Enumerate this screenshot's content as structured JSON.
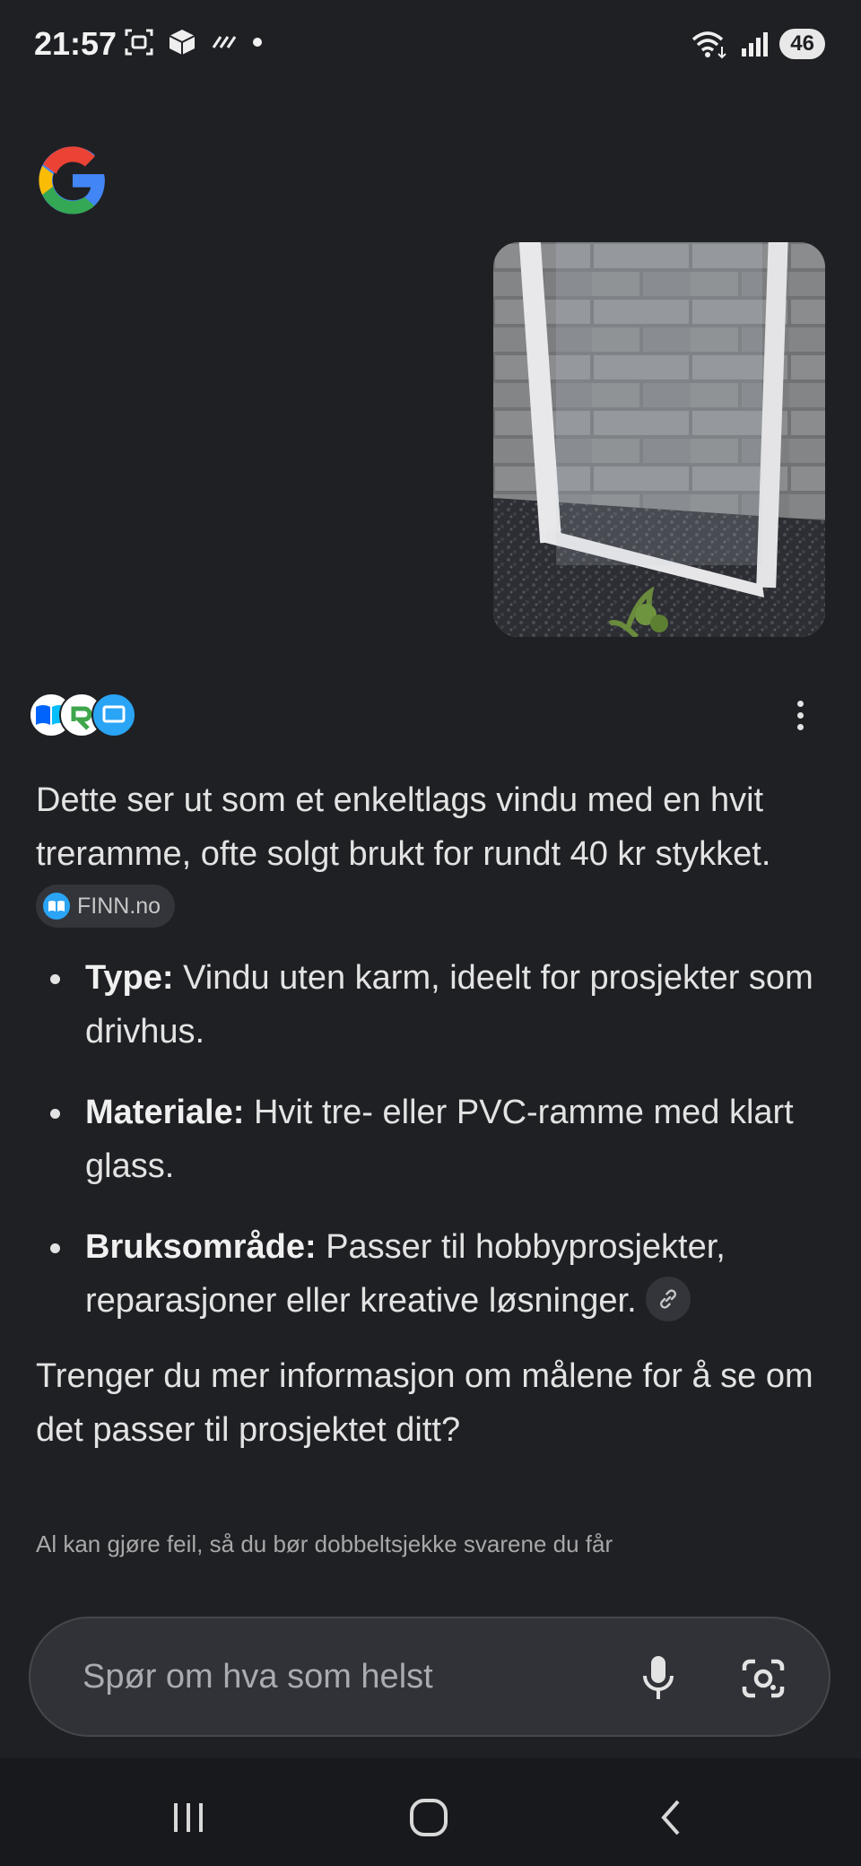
{
  "status_bar": {
    "time": "21:57",
    "icons_left": [
      "screenshot-icon",
      "cube-icon",
      "signal-stripes-icon",
      "notification-dot-icon"
    ],
    "icons_right": [
      "wifi-icon",
      "cell-signal-icon",
      "battery-icon"
    ],
    "battery": "46"
  },
  "header": {
    "logo": "google-g-logo"
  },
  "user_message": {
    "image": "photo-of-white-window-frame-against-brick-wall"
  },
  "response": {
    "sources": [
      "source-favicon-finn",
      "source-favicon-recycle",
      "source-favicon-blue"
    ],
    "intro": "Dette ser ut som et enkeltlags vindu med en hvit treramme, ofte solgt brukt for rundt 40 kr stykket.",
    "intro_chip": "FINN.no",
    "bullets": [
      {
        "term": "Type:",
        "text": " Vindu uten karm, ideelt for prosjekter som drivhus."
      },
      {
        "term": "Materiale:",
        "text": " Hvit tre- eller PVC-ramme med klart glass."
      },
      {
        "term": "Bruksområde:",
        "text": " Passer til hobbyprosjekter, reparasjoner eller kreative løsninger."
      }
    ],
    "followup": "Trenger du mer informasjon om målene for å se om det passer til prosjektet ditt?",
    "disclaimer": "Al kan gjøre feil, så du bør dobbeltsjekke svarene du får"
  },
  "input": {
    "placeholder": "Spør om hva som helst"
  },
  "colors": {
    "background": "#1f2024",
    "text": "#e3e3e3",
    "input_bg": "#303237",
    "chip_bg": "#33353a",
    "accent": "#2aa4f4"
  }
}
